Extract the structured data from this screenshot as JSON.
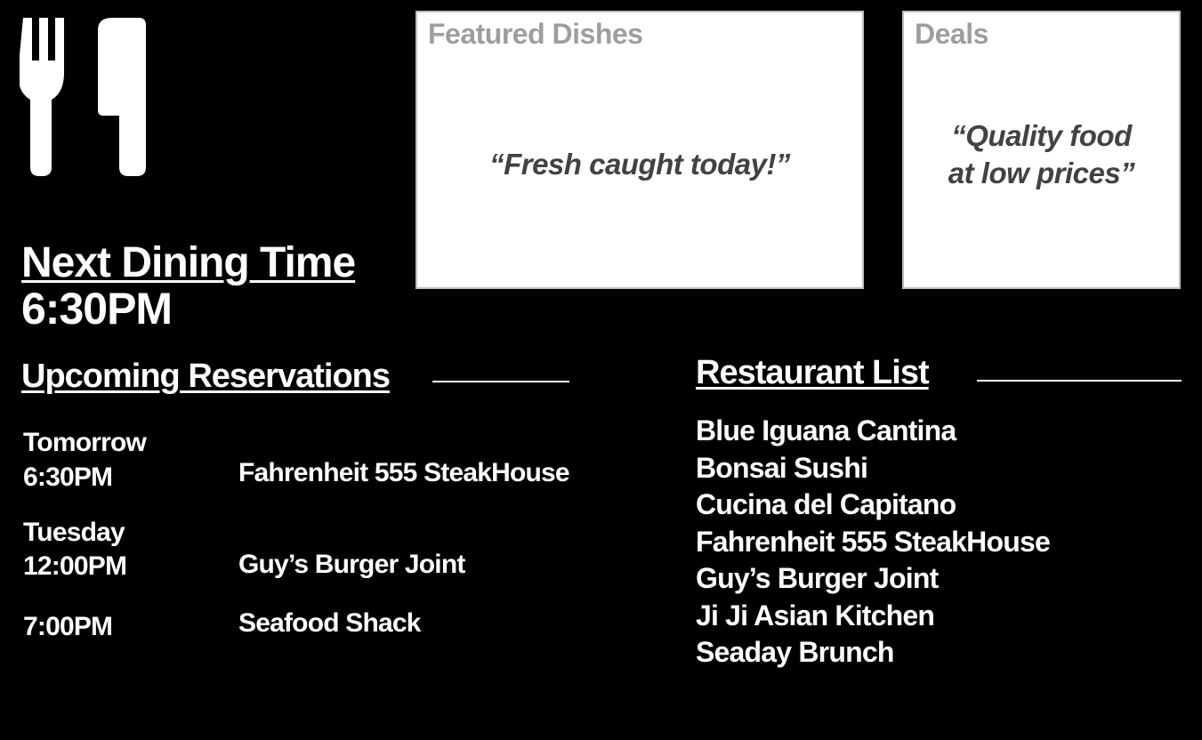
{
  "colors": {
    "background": "#000000",
    "text": "#ffffff",
    "card_background": "#ffffff",
    "card_title": "#9e9e9e",
    "card_quote": "#424242"
  },
  "logo": {
    "icon": "fork-knife-icon"
  },
  "featured": {
    "title": "Featured Dishes",
    "quote": "“Fresh caught today!”"
  },
  "deals": {
    "title": "Deals",
    "quote": "“Quality food\nat low prices”"
  },
  "next_dining": {
    "title": "Next Dining Time",
    "time": "6:30PM"
  },
  "reservations": {
    "title": "Upcoming Reservations",
    "groups": [
      {
        "day": "Tomorrow",
        "time": "6:30PM",
        "place": "Fahrenheit 555 SteakHouse"
      },
      {
        "day": "Tuesday",
        "time": "12:00PM",
        "place": "Guy’s Burger Joint"
      },
      {
        "day": "",
        "time": "7:00PM",
        "place": "Seafood Shack"
      }
    ]
  },
  "restaurants": {
    "title": "Restaurant List",
    "items": [
      "Blue Iguana Cantina",
      "Bonsai Sushi",
      "Cucina del Capitano",
      "Fahrenheit 555 SteakHouse",
      "Guy’s Burger Joint",
      "Ji Ji Asian Kitchen",
      "Seaday Brunch"
    ]
  }
}
